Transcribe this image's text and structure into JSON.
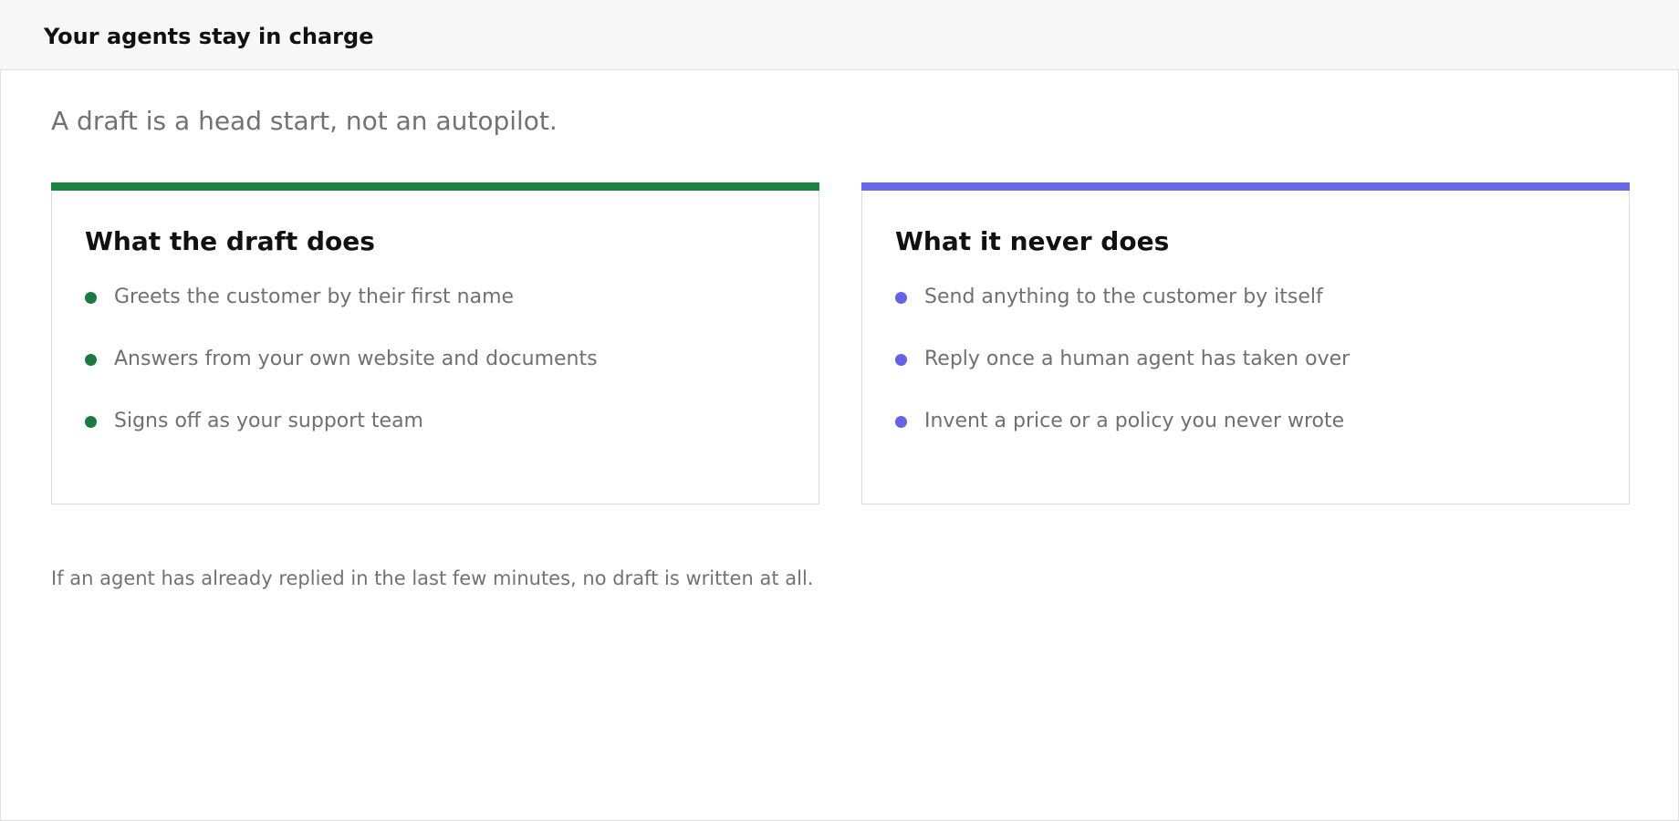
{
  "header": {
    "title": "Your agents stay in charge"
  },
  "main": {
    "subtitle": "A draft is a head start, not an autopilot.",
    "footnote": "If an agent has already replied in the last few minutes, no draft is written at all."
  },
  "cards": [
    {
      "heading": "What the draft does",
      "accent_color": "#1a8540",
      "bullet_color": "#1a7a40",
      "items": [
        "Greets the customer by their first name",
        "Answers from your own website and documents",
        "Signs off as your support team"
      ]
    },
    {
      "heading": "What it never does",
      "accent_color": "#6a6ae8",
      "bullet_color": "#6363e4",
      "items": [
        "Send anything to the customer by itself",
        "Reply once a human agent has taken over",
        "Invent a price or a policy you never wrote"
      ]
    }
  ]
}
